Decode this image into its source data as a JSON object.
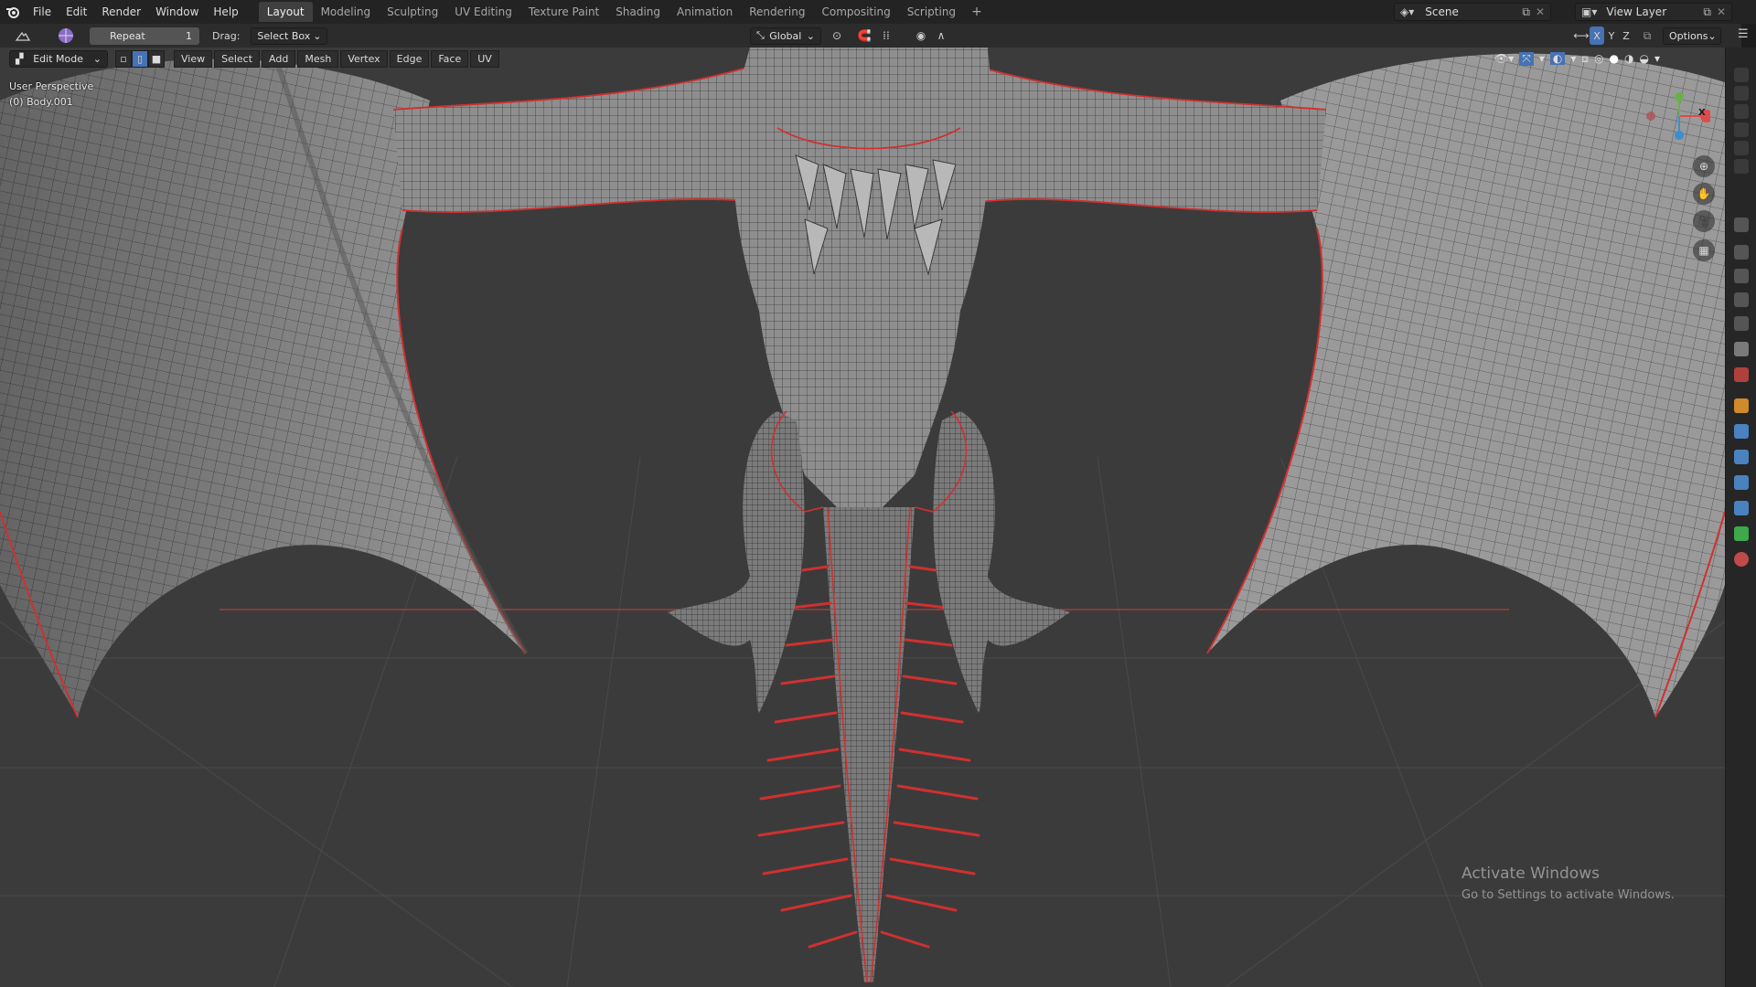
{
  "menu": {
    "file": "File",
    "edit": "Edit",
    "render": "Render",
    "window": "Window",
    "help": "Help"
  },
  "workspaces": [
    "Layout",
    "Modeling",
    "Sculpting",
    "UV Editing",
    "Texture Paint",
    "Shading",
    "Animation",
    "Rendering",
    "Compositing",
    "Scripting"
  ],
  "workspace_add": "+",
  "scene": {
    "name": "Scene",
    "view_layer": "View Layer"
  },
  "tool_settings": {
    "repeat_label": "Repeat",
    "repeat_count": "1",
    "drag_label": "Drag:",
    "drag_value": "Select Box",
    "orientation": "Global",
    "options_label": "Options",
    "axis_x": "X",
    "axis_y": "Y",
    "axis_z": "Z"
  },
  "view_header": {
    "mode": "Edit Mode",
    "menus": [
      "View",
      "Select",
      "Add",
      "Mesh",
      "Vertex",
      "Edge",
      "Face",
      "UV"
    ]
  },
  "viewport_info": {
    "perspective": "User Perspective",
    "object": "(0) Body.001"
  },
  "gizmo": {
    "x_label": "X"
  },
  "watermark": {
    "title": "Activate Windows",
    "subtitle": "Go to Settings to activate Windows."
  },
  "colors": {
    "accent": "#4772b3",
    "seam": "#e03030",
    "mesh": "#8c8c8c",
    "viewport_bg": "#3b3b3b",
    "header": "#232323"
  },
  "icons": [
    "blender-logo-icon",
    "sphere-icon",
    "editor-type-icon",
    "orientation-icon",
    "snap-icon",
    "proportional-icon",
    "gizmo-icon",
    "zoom-icon",
    "pan-icon",
    "camera-icon",
    "grid-icon"
  ]
}
